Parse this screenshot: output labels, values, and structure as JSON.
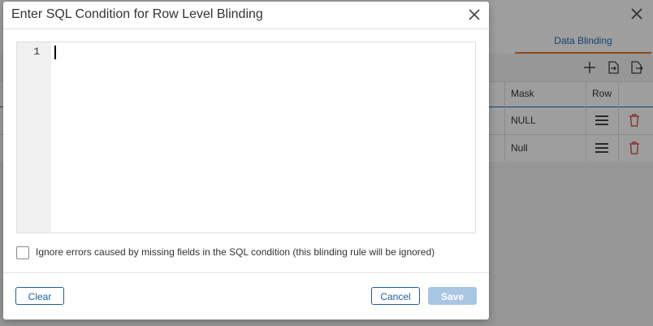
{
  "background": {
    "active_tab": "Data Blinding",
    "columns": [
      "Mask",
      "Row"
    ],
    "rows": [
      {
        "mask": "NULL"
      },
      {
        "mask": "Null"
      }
    ],
    "icons": [
      "add-icon",
      "import-icon",
      "export-icon",
      "close-icon",
      "menu-icon",
      "trash-icon"
    ]
  },
  "dialog": {
    "title": "Enter SQL Condition for Row Level Blinding",
    "editor": {
      "line_number": "1",
      "content": ""
    },
    "checkbox": {
      "label": "Ignore errors caused by missing fields in the SQL condition (this blinding rule will be ignored)",
      "checked": false
    },
    "buttons": {
      "clear": "Clear",
      "cancel": "Cancel",
      "save": "Save"
    }
  },
  "colors": {
    "accent": "#1f5f9e",
    "tab_underline": "#e87722",
    "trash": "#d9534f",
    "save_disabled": "#a9c6e3"
  }
}
